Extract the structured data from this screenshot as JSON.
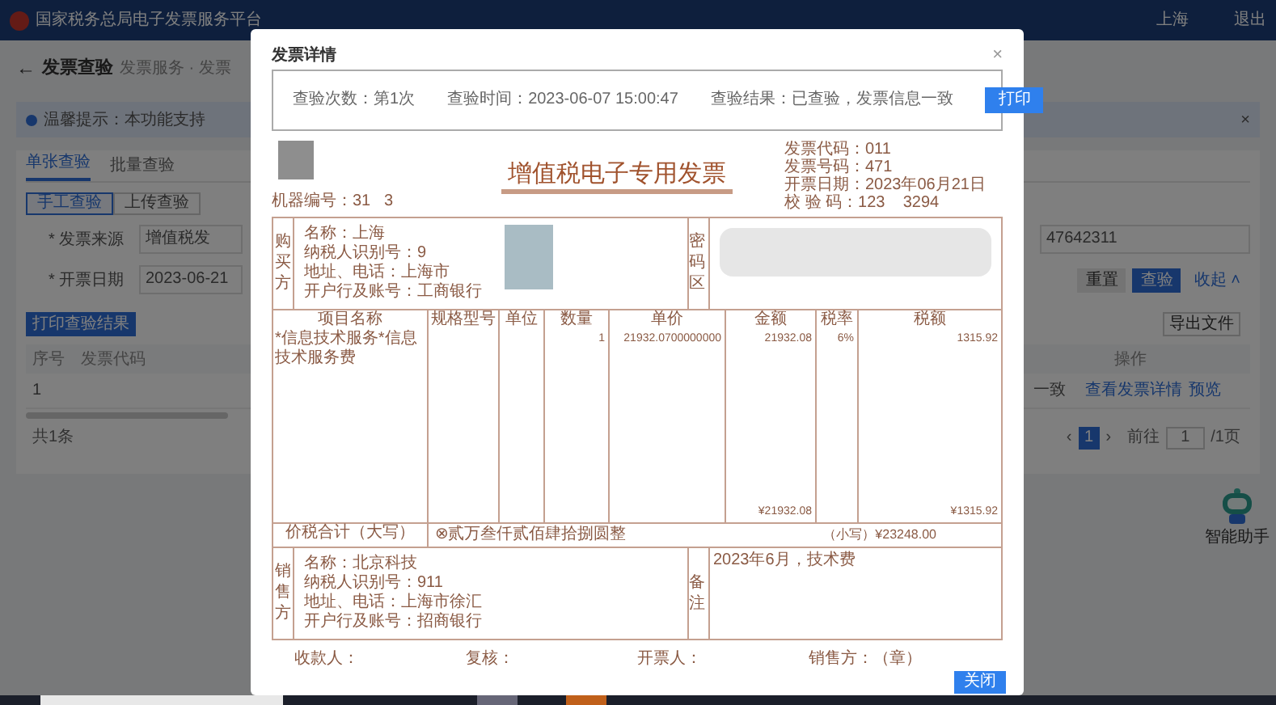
{
  "header": {
    "title": "国家税务总局电子发票服务平台",
    "user": "上海",
    "logout": "退出"
  },
  "page": {
    "back": "←",
    "title": "发票查验",
    "breadcrumb": "发票服务 · 发票",
    "notice": {
      "text": "温馨提示：本功能支持",
      "close": "×"
    },
    "tabs": [
      {
        "label": "单张查验",
        "selected": true
      },
      {
        "label": "批量查验",
        "selected": false
      }
    ],
    "modes": [
      {
        "label": "手工查验",
        "selected": true
      },
      {
        "label": "上传查验",
        "selected": false
      }
    ],
    "fields": [
      {
        "label": "* 发票来源",
        "value": "增值税发",
        "right_value": "47642311"
      },
      {
        "label": "* 开票日期",
        "value": "2023-06-21"
      }
    ],
    "form_buttons": [
      {
        "label": "重置",
        "kind": "plain"
      },
      {
        "label": "查验",
        "kind": "primary"
      },
      {
        "label": "收起 ˄",
        "kind": "link"
      }
    ],
    "print_button": "打印查验结果",
    "export_button": "导出文件",
    "table": {
      "columns": [
        "序号",
        "发票代码"
      ],
      "right_column": "操作",
      "rows": [
        {
          "index": "1",
          "result": "一致",
          "actions": [
            "查看发票详情",
            "预览"
          ]
        }
      ]
    },
    "total": "共1条",
    "pagination": {
      "prev": "‹",
      "pages": [
        {
          "label": "1",
          "selected": true
        }
      ],
      "next": "›",
      "goto": "前往",
      "page_input": "1",
      "page_count": "/1页"
    },
    "assistant": "智能助手"
  },
  "modal": {
    "title": "发票详情",
    "close": "×",
    "summary": [
      {
        "label": "查验次数：第1次"
      },
      {
        "label": "查验时间：2023-06-07 15:00:47"
      },
      {
        "label": "查验结果：已查验，发票信息一致"
      }
    ],
    "print_button": "打印",
    "invoice": {
      "title": "增值税电子专用发票",
      "machine_no": "机器编号：31   3",
      "meta": [
        "发票代码：011",
        "发票号码：471",
        "开票日期：2023年06月21日",
        "校 验 码：123    3294"
      ],
      "buyer_label": "购买方",
      "buyer": [
        "名称：上海",
        "纳税人识别号：9",
        "地址、电话：上海市",
        "开户行及账号：工商银行"
      ],
      "cipher_label": "密码区",
      "columns": [
        "项目名称",
        "规格型号",
        "单位",
        "数量",
        "单价",
        "金额",
        "税率",
        "税额"
      ],
      "items": [
        {
          "name": "*信息技术服务*信息技术服务费",
          "quantity": "1",
          "unit_price": "21932.0700000000",
          "amount": "21932.08",
          "tax_rate": "6%",
          "tax": "1315.92"
        }
      ],
      "subtotal_amount": "¥21932.08",
      "subtotal_tax": "¥1315.92",
      "total_label": "价税合计（大写）",
      "total_words": "⊗贰万叁仟贰佰肆拾捌圆整",
      "total_figures": "（小写）¥23248.00",
      "seller_label": "销售方",
      "seller": [
        "名称：北京科技",
        "纳税人识别号：911",
        "地址、电话：上海市徐汇",
        "开户行及账号：招商银行"
      ],
      "remark_label": "备注",
      "remark": "2023年6月，技术费",
      "signatures": [
        "收款人：",
        "复核：",
        "开票人：",
        "销售方：（章）"
      ]
    },
    "close_button": "关闭"
  }
}
